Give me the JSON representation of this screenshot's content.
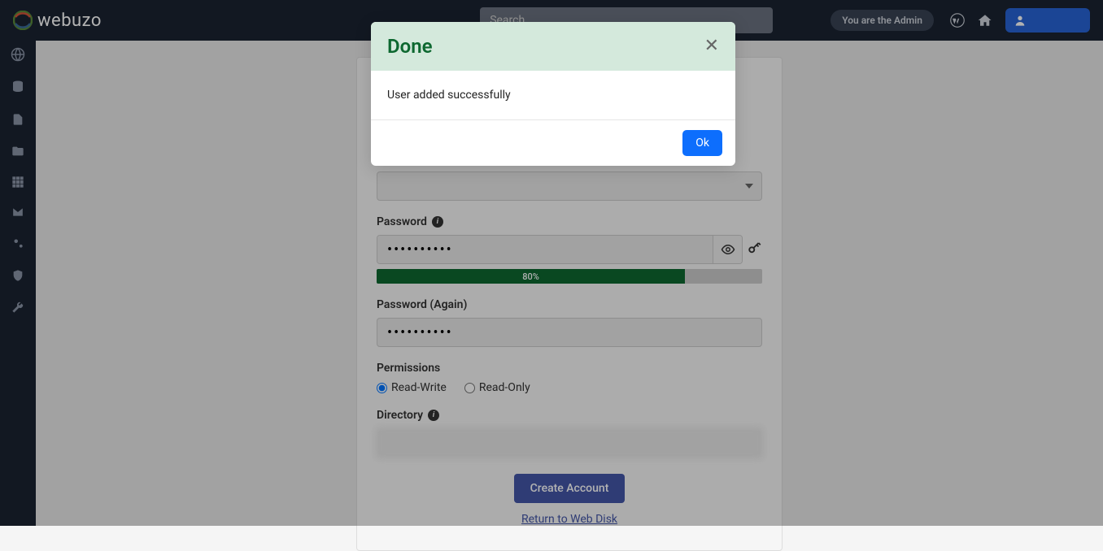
{
  "header": {
    "logo_text": "webuzo",
    "search_placeholder": "Search",
    "admin_badge": "You are the Admin"
  },
  "form": {
    "password_label": "Password",
    "password_value": "••••••••••",
    "strength_text": "80%",
    "strength_percent": 80,
    "password_again_label": "Password (Again)",
    "password_again_value": "••••••••••",
    "permissions_label": "Permissions",
    "permission_rw": "Read-Write",
    "permission_ro": "Read-Only",
    "directory_label": "Directory",
    "directory_value": "                                              ",
    "create_button": "Create Account",
    "return_link": "Return to Web Disk"
  },
  "modal": {
    "title": "Done",
    "message": "User added successfully",
    "ok_button": "Ok"
  }
}
